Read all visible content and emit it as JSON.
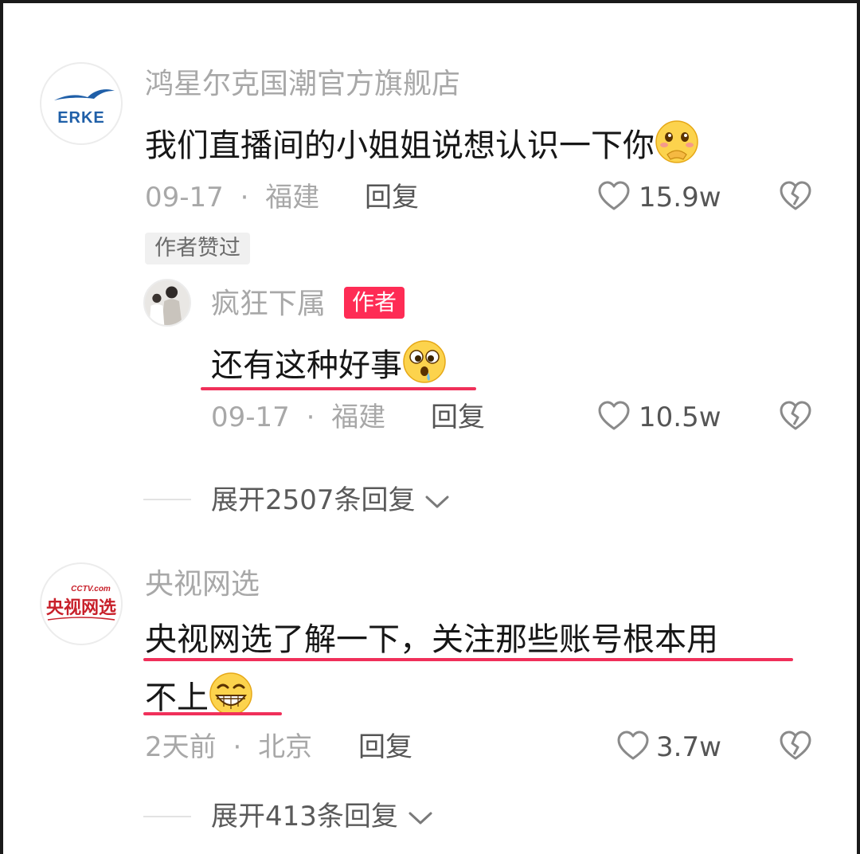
{
  "comments": [
    {
      "username": "鸿星尔克国潮官方旗舰店",
      "avatar_logo_text": "ERKE",
      "text": "我们直播间的小姐姐说想认识一下你",
      "emoji": "shy-covering-mouth-emoji",
      "date": "09-17",
      "separator": "·",
      "location": "福建",
      "reply_label": "回复",
      "likes": "15.9w",
      "liked_by_author_tag": "作者赞过",
      "replies": [
        {
          "username": "疯狂下属",
          "author_tag": "作者",
          "text": "还有这种好事",
          "emoji": "drooling-emoji",
          "date": "09-17",
          "separator": "·",
          "location": "福建",
          "reply_label": "回复",
          "likes": "10.5w"
        }
      ],
      "expand_label": "展开2507条回复"
    },
    {
      "username": "央视网选",
      "avatar_logo_text": "央视网选",
      "avatar_logo_small": "CCTV.com",
      "text_line1": "央视网选了解一下，关注那些账号根本用",
      "text_line2": "不上",
      "emoji": "grinning-emoji",
      "date": "2天前",
      "separator": "·",
      "location": "北京",
      "reply_label": "回复",
      "likes": "3.7w",
      "expand_label": "展开413条回复"
    }
  ],
  "colors": {
    "accent": "#fe2c55",
    "underline": "#f0305a",
    "erke_blue": "#1f5fa8",
    "cctv_red": "#c8202a"
  }
}
